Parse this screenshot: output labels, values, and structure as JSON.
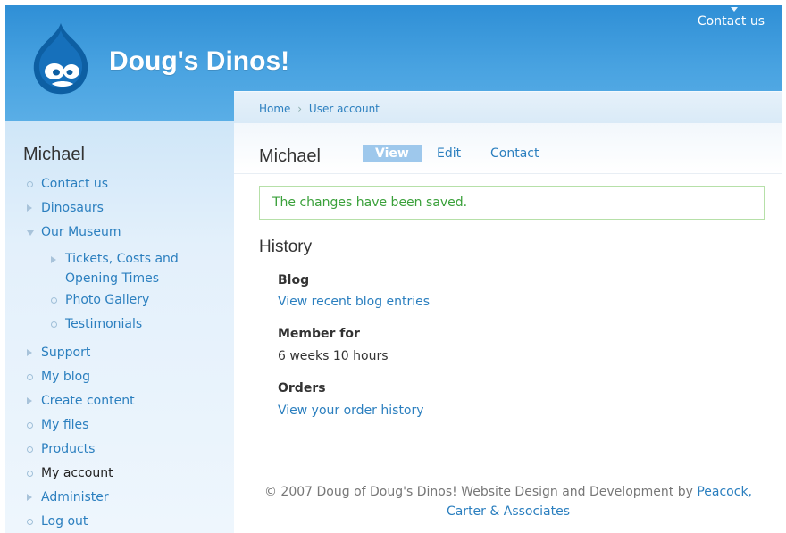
{
  "header": {
    "site_name": "Doug's Dinos!",
    "contact_link": "Contact us"
  },
  "sidebar": {
    "title": "Michael",
    "items": [
      {
        "label": "Contact us",
        "icon": "leaf-bullet"
      },
      {
        "label": "Dinosaurs",
        "icon": "collapsed-arrow"
      },
      {
        "label": "Our Museum",
        "icon": "expanded-arrow"
      },
      {
        "label": "Tickets, Costs and",
        "label2": "Opening Times",
        "icon": "collapsed-arrow"
      },
      {
        "label": "Photo Gallery",
        "icon": "leaf-bullet"
      },
      {
        "label": "Testimonials",
        "icon": "leaf-bullet"
      },
      {
        "label": "Support",
        "icon": "collapsed-arrow"
      },
      {
        "label": "My blog",
        "icon": "leaf-bullet"
      },
      {
        "label": "Create content",
        "icon": "collapsed-arrow"
      },
      {
        "label": "My files",
        "icon": "leaf-bullet"
      },
      {
        "label": "Products",
        "icon": "leaf-bullet"
      },
      {
        "label": "My account",
        "icon": "leaf-bullet",
        "active": true
      },
      {
        "label": "Administer",
        "icon": "collapsed-arrow"
      },
      {
        "label": "Log out",
        "icon": "leaf-bullet"
      }
    ]
  },
  "breadcrumb": {
    "home": "Home",
    "separator": "›",
    "current": "User account"
  },
  "page": {
    "title": "Michael",
    "tabs": [
      "View",
      "Edit",
      "Contact"
    ],
    "active_tab": "View",
    "status_message": "The changes have been saved.",
    "history_title": "History",
    "blog_label": "Blog",
    "blog_link": "View recent blog entries",
    "member_label": "Member for",
    "member_value": "6 weeks 10 hours",
    "orders_label": "Orders",
    "orders_link": "View your order history"
  },
  "footer": {
    "text": "© 2007 Doug of Doug's Dinos! Website Design and Development by ",
    "link1": "Peacock,",
    "link2": "Carter & Associates"
  },
  "colors": {
    "header_blue": "#2f8fd6",
    "link": "#2b7fbf",
    "status_green": "#3aa03a",
    "tab_active": "#9ec8ec"
  }
}
